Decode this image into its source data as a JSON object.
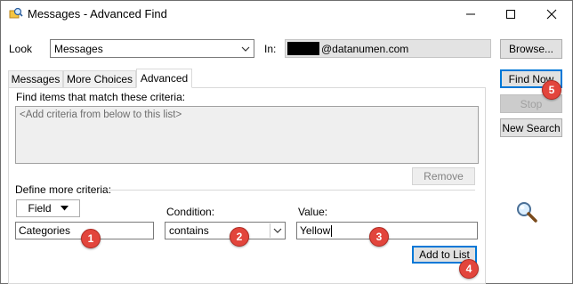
{
  "window": {
    "title": "Messages - Advanced Find",
    "icons": {
      "app": "search-find-icon",
      "minimize": "minimize-icon",
      "maximize": "maximize-icon",
      "close": "close-icon"
    }
  },
  "top": {
    "look_label": "Look",
    "look_value": "Messages",
    "in_label": "In:",
    "in_value": "@datanumen.com",
    "browse_button": "Browse..."
  },
  "tabs": [
    {
      "label": "Messages",
      "active": false
    },
    {
      "label": "More Choices",
      "active": false
    },
    {
      "label": "Advanced",
      "active": true
    }
  ],
  "advanced": {
    "criteria_heading": "Find items that match these criteria:",
    "criteria_placeholder": "<Add criteria from below to this list>",
    "remove_button": "Remove",
    "define_heading": "Define more criteria:",
    "field_button": "Field",
    "condition_label": "Condition:",
    "value_label": "Value:",
    "field_value": "Categories",
    "condition_value": "contains",
    "value_value": "Yellow",
    "add_button": "Add to List"
  },
  "side": {
    "find_now": "Find Now",
    "stop": "Stop",
    "new_search": "New Search",
    "magnifier_icon": "magnifier-icon"
  },
  "badges": [
    "1",
    "2",
    "3",
    "4",
    "5"
  ],
  "colors": {
    "badge": "#e2453c",
    "accent": "#0078d7",
    "button": "#e1e1e1"
  }
}
